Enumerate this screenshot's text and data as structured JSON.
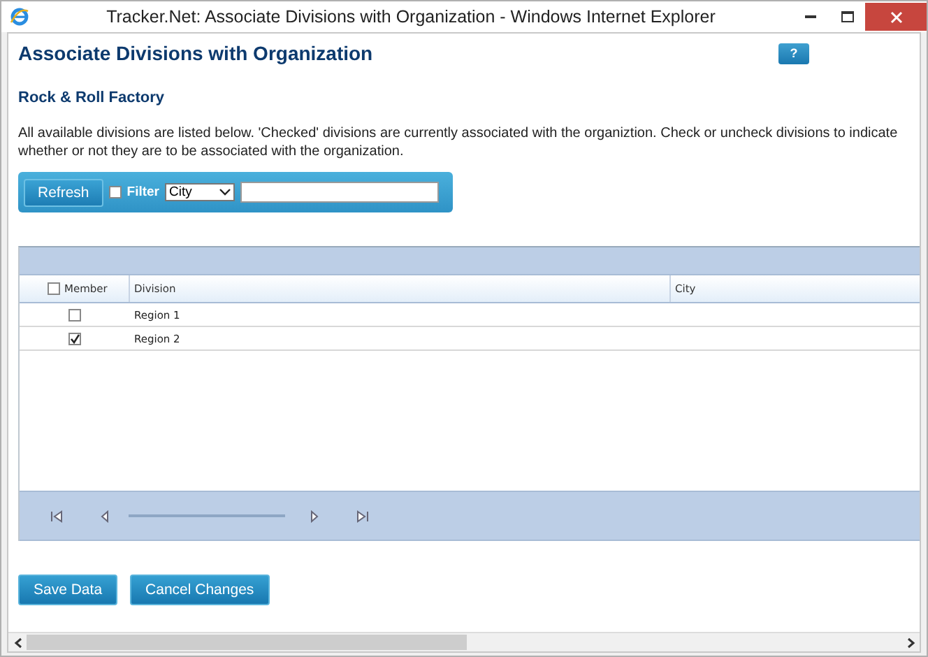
{
  "window": {
    "title": "Tracker.Net: Associate Divisions with Organization - Windows Internet Explorer"
  },
  "page": {
    "heading": "Associate Divisions with Organization",
    "help_button": "?",
    "organization": "Rock & Roll Factory",
    "description": "All available divisions are listed below. 'Checked' divisions are currently associated with the organiztion. Check or uncheck divisions to indicate whether or not they are to be associated with the organization."
  },
  "toolbar": {
    "refresh_button": "Refresh",
    "filter": {
      "label": "Filter",
      "checked": false
    },
    "filter_field": {
      "value": "City"
    }
  },
  "grid": {
    "select_all": {
      "checked": false
    },
    "columns": [
      "Member",
      "Division",
      "City"
    ],
    "rows": [
      {
        "checked": false,
        "division": "Region 1"
      },
      {
        "checked": true,
        "division": "Region 2"
      }
    ]
  },
  "buttons": [
    "Save Data",
    "Cancel Changes"
  ]
}
